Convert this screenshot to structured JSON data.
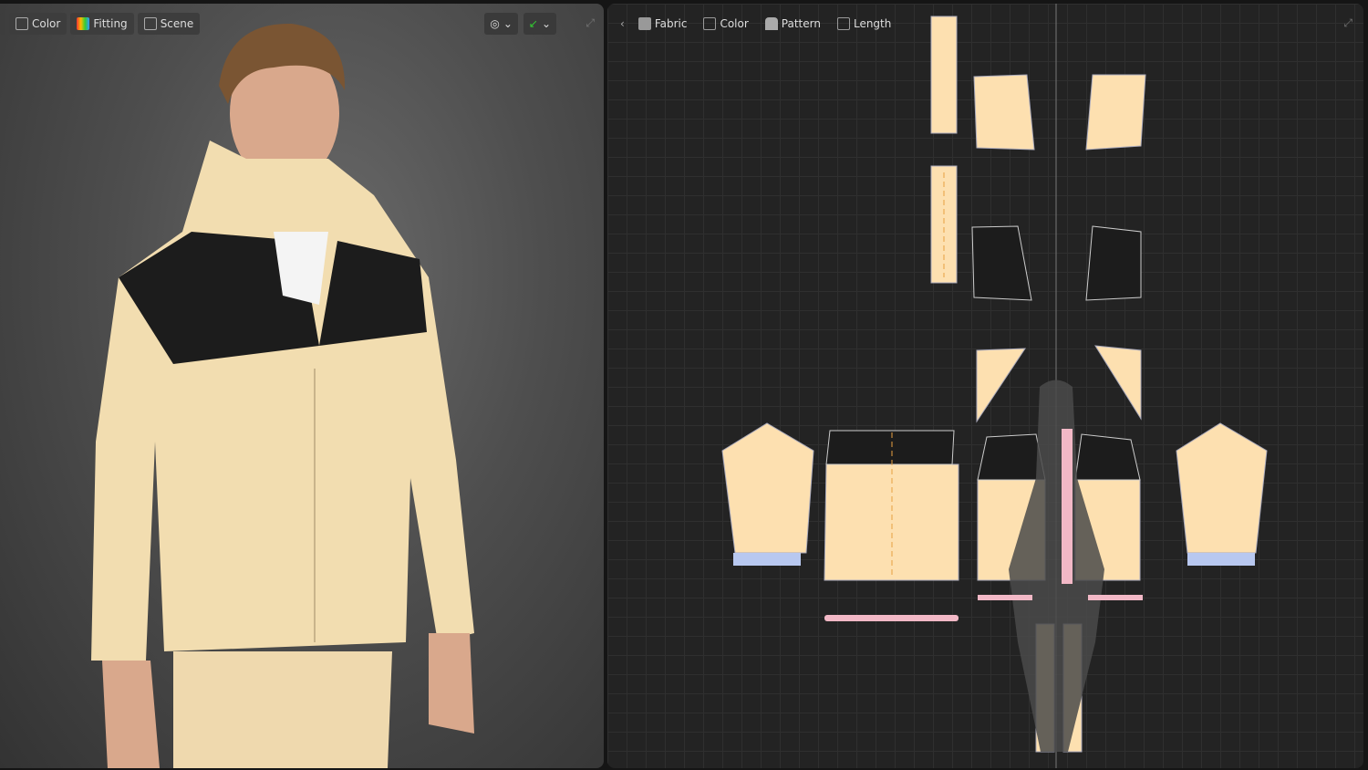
{
  "viewport3d": {
    "toolbar": [
      {
        "label": "Color",
        "icon": "color-fabric-icon"
      },
      {
        "label": "Fitting",
        "icon": "fitting-heatmap-icon"
      },
      {
        "label": "Scene",
        "icon": "scene-icon"
      }
    ],
    "right_tools": [
      {
        "icon": "camera-view-icon"
      },
      {
        "icon": "measure-tool-icon"
      }
    ]
  },
  "pattern_view": {
    "toolbar": [
      {
        "label": "Fabric",
        "icon": "fabric-icon"
      },
      {
        "label": "Color",
        "icon": "color-icon"
      },
      {
        "label": "Pattern",
        "icon": "pattern-icon"
      },
      {
        "label": "Length",
        "icon": "length-icon"
      }
    ]
  },
  "colors": {
    "fabric": "#fde0b0",
    "black_panel": "#1c1c1c",
    "rib": "#b8c8f0",
    "accent_pink": "#f2b8c6"
  }
}
